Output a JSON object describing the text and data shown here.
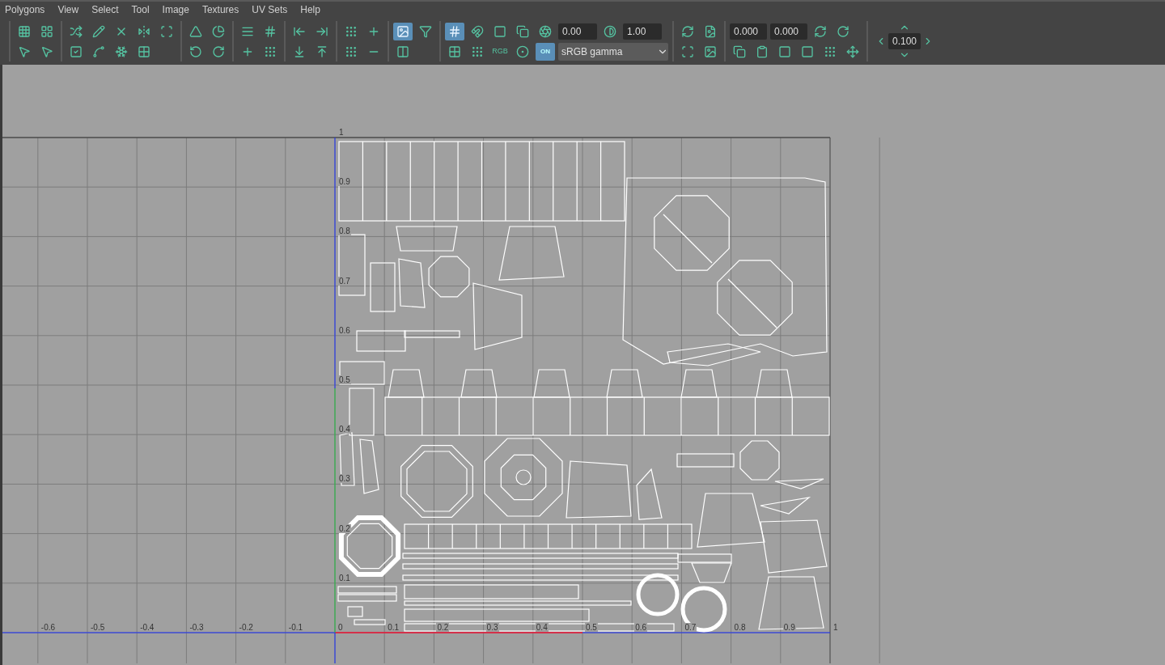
{
  "menu": [
    "Polygons",
    "View",
    "Select",
    "Tool",
    "Image",
    "Textures",
    "UV Sets",
    "Help"
  ],
  "toolbar": {
    "toggles": [
      {
        "on": true
      },
      {
        "on": true
      }
    ],
    "exposure": "0.00",
    "gamma": "1.00",
    "channel_label": "RGB",
    "color_management": {
      "label": "ON",
      "on": true
    },
    "view_transform": "sRGB gamma",
    "u_value": "0.000",
    "v_value": "0.000",
    "step": "0.100"
  },
  "uv_editor": {
    "x_axis_labels": [
      "-0.6",
      "-0.5",
      "-0.4",
      "-0.3",
      "-0.2",
      "-0.1",
      "0",
      "0.1",
      "0.2",
      "0.3",
      "0.4",
      "0.5",
      "0.6",
      "0.7",
      "0.8",
      "0.9",
      "1"
    ],
    "y_axis_labels": [
      "1",
      "0.9",
      "0.8",
      "0.7",
      "0.6",
      "0.5",
      "0.4",
      "0.3",
      "0.2",
      "0.1"
    ]
  }
}
